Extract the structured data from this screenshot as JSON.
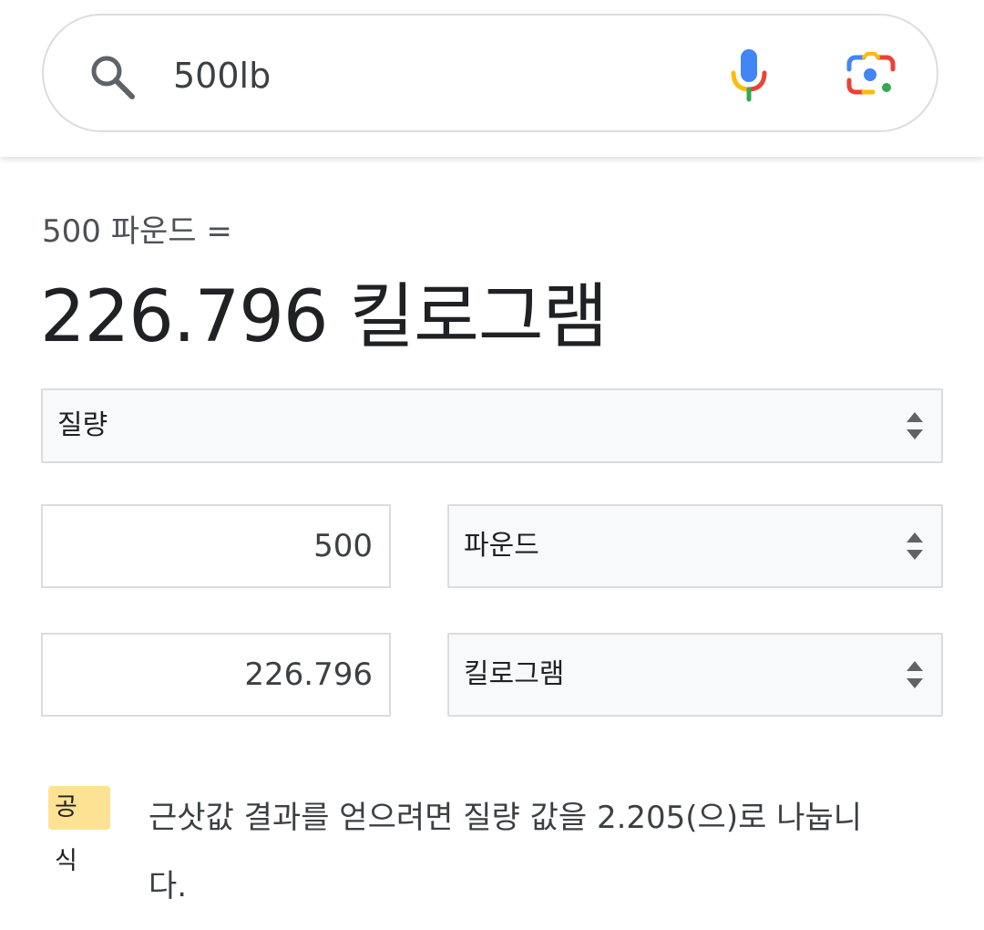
{
  "search": {
    "query": "500lb"
  },
  "conversion": {
    "label": "500 파운드 =",
    "result": "226.796 킬로그램"
  },
  "quantity_select": {
    "selected": "질량"
  },
  "from": {
    "value": "500",
    "unit": "파운드"
  },
  "to": {
    "value": "226.796",
    "unit": "킬로그램"
  },
  "formula": {
    "badge_line1": "공",
    "badge_line2": "식",
    "text_line1": "근삿값 결과를 얻으려면 질량 값을 2.205(으)로 나눕니",
    "text_line2": "다."
  },
  "colors": {
    "badge": "#fde293",
    "border": "#dadce0",
    "select_bg": "#f8f9fa",
    "google_blue": "#4285f4",
    "google_red": "#ea4335",
    "google_yellow": "#fbbc04",
    "google_green": "#34a853"
  },
  "icons": {
    "search": "search-icon",
    "mic": "mic-icon",
    "lens": "lens-icon",
    "select_arrows": "sort-arrows-icon"
  }
}
